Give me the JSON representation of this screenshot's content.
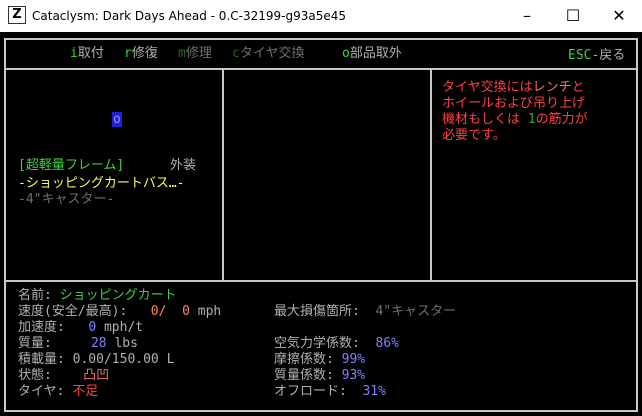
{
  "window": {
    "title": "Cataclysm: Dark Days Ahead - 0.C-32199-g93a5e45",
    "app_icon": "Z",
    "minimize": "–",
    "maximize": "☐",
    "close": "✕"
  },
  "menu": {
    "install_key": "i",
    "install_label": "取付",
    "repair_key": "r",
    "repair_label": "修復",
    "mend_key": "m",
    "mend_label": "修理",
    "tire_key": "c",
    "tire_label": "タイヤ交換",
    "remove_key": "o",
    "remove_label": "部品取外",
    "esc_key": "ESC",
    "esc_label": "-戻る"
  },
  "left_panel": {
    "cursor_glyph": "o",
    "frame_line": "[超軽量フレーム]",
    "exterior": "外装",
    "part_1": "-ショッピングカートバス…-",
    "part_2": "-4\"キャスター-"
  },
  "message": {
    "l1_a": "タイヤ交換には",
    "l1_b": "レンチ",
    "l1_c": "と",
    "l2_a": "ホイール",
    "l2_b": "および",
    "l2_c": "吊り上げ",
    "l3_a": "機材",
    "l3_b": "もしくは ",
    "l3_c": "1",
    "l3_d": "の筋力が",
    "l4": "必要です。"
  },
  "stats": {
    "name_label": "名前:",
    "name_value": "ショッピングカート",
    "speed_label": "速度(安全/最高):",
    "speed_safe": "0/",
    "speed_max": "0",
    "speed_unit": "mph",
    "accel_label": "加速度:",
    "accel_value": "0",
    "accel_unit": "mph/t",
    "mass_label": "質量:",
    "mass_value": "28",
    "mass_unit": "lbs",
    "cargo_label": "積載量:",
    "cargo_value": "0.00/150.00 L",
    "status_label": "状態:",
    "status_value": "凸凹",
    "tire_label": "タイヤ:",
    "tire_value": "不足",
    "most_damaged_label": "最大損傷箇所:",
    "most_damaged_value": "4\"キャスター",
    "aero_label": "空気力学係数:",
    "aero_value": "86%",
    "friction_label": "摩擦係数:",
    "friction_value": "99%",
    "mass_coef_label": "質量係数:",
    "mass_coef_value": "93%",
    "offroad_label": "オフロード:",
    "offroad_value": "31%"
  }
}
